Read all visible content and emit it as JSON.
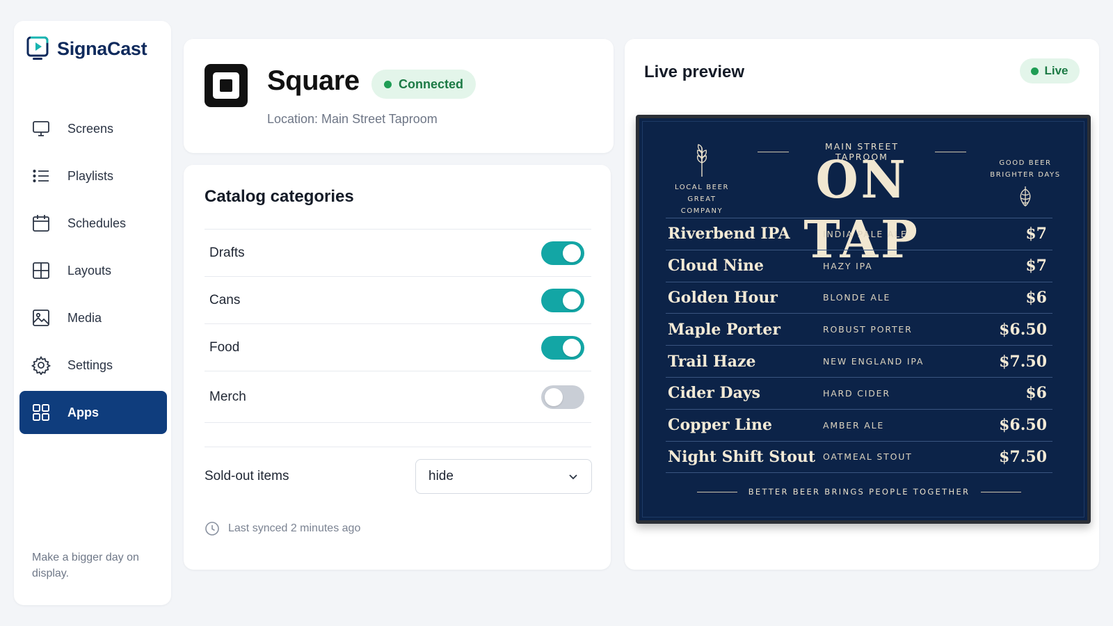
{
  "app": {
    "name": "SignaCast",
    "tagline": "Make a bigger day on display."
  },
  "colors": {
    "brand_navy": "#0f3d7d",
    "toggle_on": "#13a6a5",
    "toggle_off": "#c9ced6",
    "status_green": "#1f9d55",
    "board_bg": "#0c2348"
  },
  "sidebar": {
    "items": [
      {
        "label": "Screens",
        "icon": "monitor-icon",
        "active": false
      },
      {
        "label": "Playlists",
        "icon": "list-icon",
        "active": false
      },
      {
        "label": "Schedules",
        "icon": "calendar-icon",
        "active": false
      },
      {
        "label": "Layouts",
        "icon": "layout-grid-icon",
        "active": false
      },
      {
        "label": "Media",
        "icon": "image-icon",
        "active": false
      },
      {
        "label": "Settings",
        "icon": "gear-icon",
        "active": false
      },
      {
        "label": "Apps",
        "icon": "apps-grid-icon",
        "active": true
      }
    ]
  },
  "integration": {
    "name": "Square",
    "status": "Connected",
    "location": "Location: Main Street Taproom"
  },
  "catalog": {
    "title": "Catalog categories",
    "categories": [
      {
        "label": "Drafts",
        "enabled": true
      },
      {
        "label": "Cans",
        "enabled": true
      },
      {
        "label": "Food",
        "enabled": true
      },
      {
        "label": "Merch",
        "enabled": false
      }
    ],
    "sold_out_label": "Sold-out items",
    "sold_out_value": "hide",
    "last_synced": "Last synced 2 minutes ago"
  },
  "preview": {
    "title": "Live preview",
    "status": "Live",
    "board": {
      "kicker": "MAIN STREET TAPROOM",
      "headline": "ON TAP",
      "left_brand_line1": "LOCAL BEER",
      "left_brand_line2": "GREAT COMPANY",
      "right_brand_line1": "GOOD BEER",
      "right_brand_line2": "BRIGHTER DAYS",
      "items": [
        {
          "name": "Riverbend IPA",
          "style": "INDIA PALE ALE",
          "price": "$7"
        },
        {
          "name": "Cloud Nine",
          "style": "HAZY IPA",
          "price": "$7"
        },
        {
          "name": "Golden Hour",
          "style": "BLONDE ALE",
          "price": "$6"
        },
        {
          "name": "Maple Porter",
          "style": "ROBUST PORTER",
          "price": "$6.50"
        },
        {
          "name": "Trail Haze",
          "style": "NEW ENGLAND IPA",
          "price": "$7.50"
        },
        {
          "name": "Cider Days",
          "style": "HARD CIDER",
          "price": "$6"
        },
        {
          "name": "Copper Line",
          "style": "AMBER ALE",
          "price": "$6.50"
        },
        {
          "name": "Night Shift Stout",
          "style": "OATMEAL STOUT",
          "price": "$7.50"
        }
      ],
      "footer": "BETTER BEER BRINGS PEOPLE TOGETHER"
    }
  }
}
